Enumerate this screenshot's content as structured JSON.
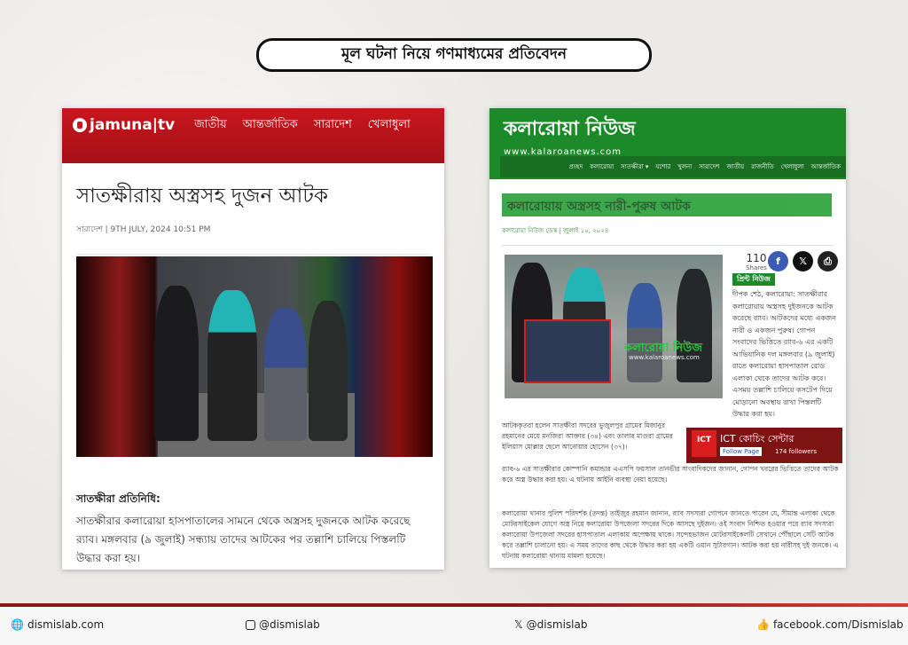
{
  "headline": "মূল ঘটনা নিয়ে গণমাধ্যমের প্রতিবেদন",
  "jamuna": {
    "logo": "jamuna|tv",
    "nav": [
      "জাতীয়",
      "আন্তর্জাতিক",
      "সারাদেশ",
      "খেলাধুলা"
    ],
    "title": "সাতক্ষীরায় অস্ত্রসহ দুজন আটক",
    "meta": "সারাদেশ | 9TH JULY, 2024 10:51 PM",
    "byline": "সাতক্ষীরা প্রতিনিধি:",
    "body": "সাতক্ষীরার কলারোয়া হাসপাতালের সামনে থেকে অস্ত্রসহ দুজনকে আটক করেছে র‍্যাব। মঙ্গলবার (৯ জুলাই) সন্ধ্যায় তাদের আটকের পর তল্লাশি চালিয়ে পিস্তলটি উদ্ধার করা হয়।"
  },
  "kalaroa": {
    "brand": "কলারোয়া নিউজ",
    "url": "www.kalaroanews.com",
    "nav": [
      "প্রচ্ছদ",
      "কলারোয়া",
      "সাতক্ষীরা ▾",
      "যশোর",
      "খুলনা",
      "সারাদেশ",
      "জাতীয়",
      "রাজনীতি",
      "খেলাধুলা",
      "আন্তর্জাতিক"
    ],
    "title": "কলারোয়ায় অস্ত্রসহ নারী-পুরুষ আটক",
    "meta": "কলারোয়া নিউজ ডেস্ক | জুলাই ১০, ২০২৪",
    "share_count": "110",
    "share_label": "Shares",
    "print_label": "প্রিন্ট নিউজ",
    "watermark": "কলারোয়া নিউজ",
    "watermark_url": "www.kalaroanews.com",
    "side_text": "দীপক শেঠ, কলারোয়া: সাতক্ষীরার কলারোয়ায় অস্ত্রসহ দুইজনকে আটক করেছে র‍্যাব। আটকদের মধ্যে একজন নারী ও একজন পুরুষ। গোপন সংবাদের ভিত্তিতে র‍্যাব-৬ এর একটি আভিযানিক দল মঙ্গলবার (৯ জুলাই) রাতে কলারোয়া হাসপাতাল রোড এলাকা থেকে তাদের আটক করে। এসময় তল্লাশি চালিয়ে কসটেপ দিয়ে মোড়ানো অবস্থায় রাখা পিস্তলটি উদ্ধার করা হয়।",
    "para1": "আটককৃতরা হলেন সাতক্ষীরা সদরের ভুজুলপুর গ্রামের মিজানুর রহমানের মেয়ে মনজিরা আক্তার (৩৪) এবং তালার মাগুরা গ্রামের ইলিয়াস মোল্লার ছেলে আনোয়ার হোসেন (৩৭)।",
    "para2": "র‍্যাব-৬ এর সাতক্ষীরার কোম্পানি কমান্ডার এএসপি ফয়সাল তানভীর সাংবাদিকদের জানান, গোপন খবরের ভিত্তিতে তাদের আটক করে অস্ত্র উদ্ধার করা হয়। এ ঘটনায় আইনি ব্যবস্থা নেয়া হয়েছে।",
    "para3": "কলারোয়া থানার পুলিশ পরিদর্শক (তদন্ত) তাইজুর রহমান জানান, র‍্যাব সদস্যরা গোপনে জানতে পারেন যে, সীমান্ত এলাকা থেকে মোটরসাইকেল যোগে অস্ত্র নিয়ে কলারোয়া উপজেলা সদরের দিকে আসছে দুইজন। ওই সংবাদ নিশ্চিত হওয়ার পরে র‍্যাব সদস্যরা কলারোয়া উপজেলা সদরের হাসপাতাল এলাকায় অপেক্ষায় থাকে। সন্দেহভাজন মোটরসাইকেলটি সেখানে পৌঁছালে সেটি আটক করে তল্লাশি চালানো হয়। এ সময় তাদের কাছ থেকে উদ্ধার করা হয় একটি ওয়ান সুটারগান। আটক করা হয় নারীসহ দুই জনকে। এ ঘটনায় কলারোয়া থানায় মামলা হয়েছে।",
    "ad": {
      "logo": "ICT",
      "title": "ICT কোচিং সেন্টার",
      "follow": "Follow Page",
      "followers": "174 followers"
    }
  },
  "footer": {
    "web": "dismislab.com",
    "instagram": "@dismislab",
    "x": "@dismislab",
    "facebook": "facebook.com/Dismislab"
  },
  "colors": {
    "jamuna_red": "#c8161d",
    "kalaroa_green": "#1d8a2a",
    "footer_red": "#8b1818"
  }
}
